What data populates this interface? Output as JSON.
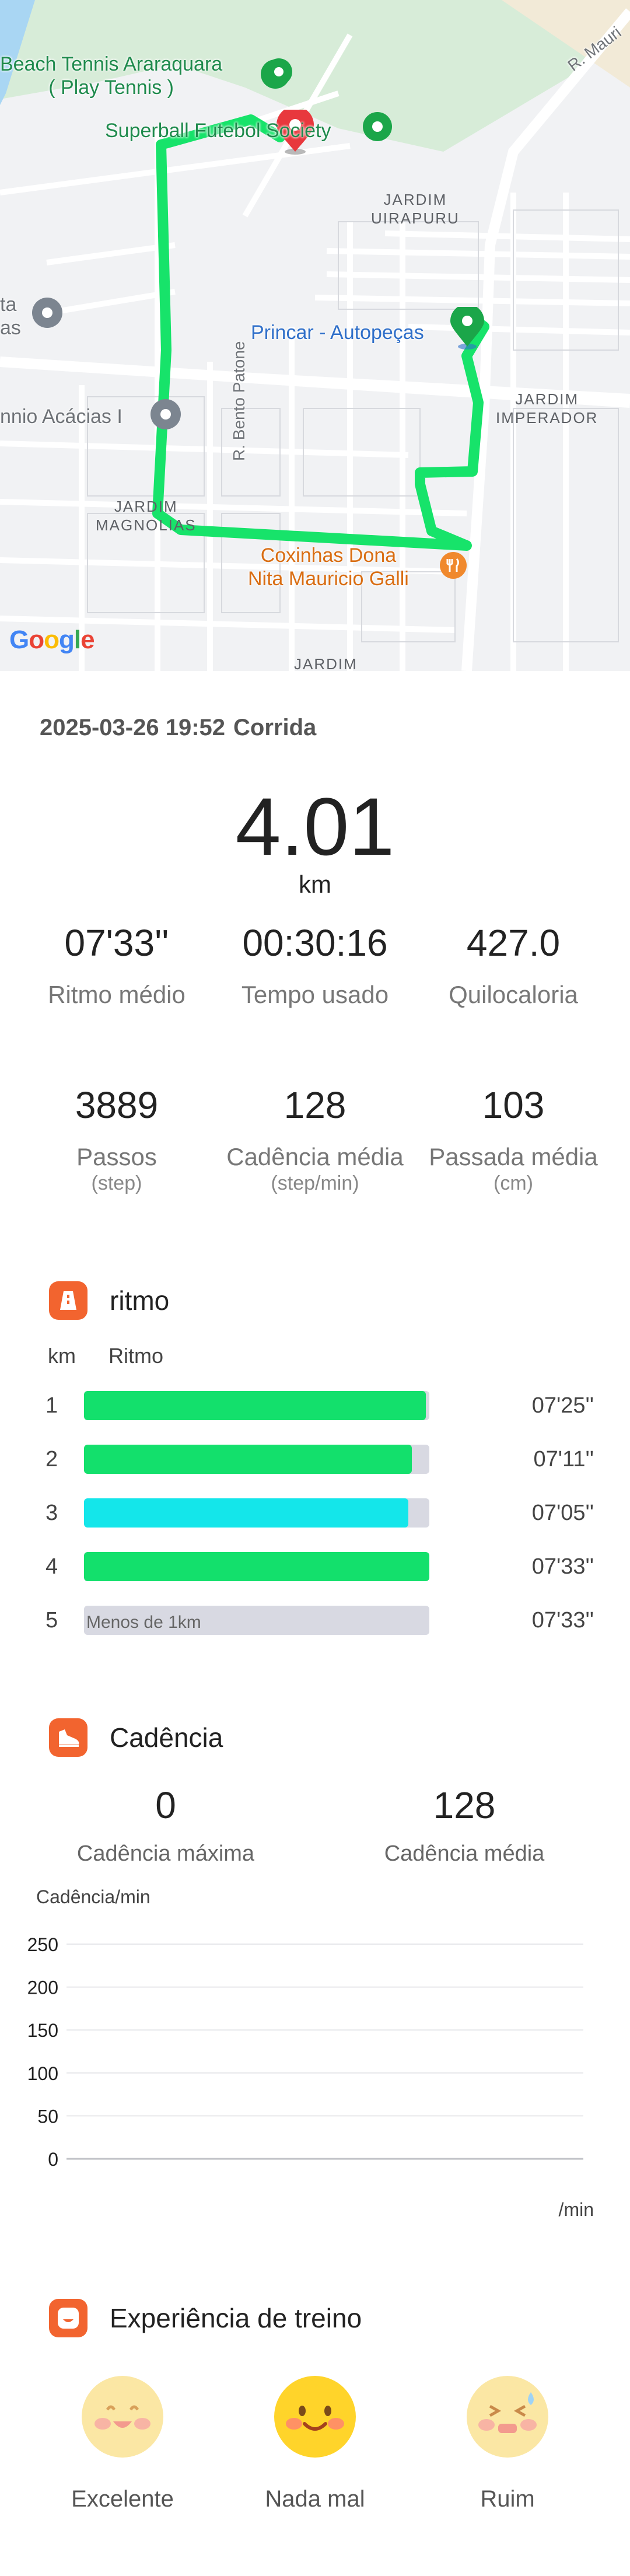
{
  "map": {
    "labels": {
      "beach_tennis": "Beach Tennis Araraquara\n( Play Tennis )",
      "superball": "Superball Futebol Society",
      "princar": "Princar - Autopeças",
      "coxinhas": "Coxinhas Dona\nNita Mauricio Galli",
      "acacias": "nnio Acácias I",
      "ta": "ta\nas",
      "rua_bento": "R. Bento Patone",
      "r_mauri": "R. Mauri",
      "jd_uirapuru": "JARDIM\nUIRAPURU",
      "jd_imperador": "JARDIM\nIMPERADOR",
      "jd_magnolias": "JARDIM\nMAGNOLIAS",
      "jd_bottom": "JARDIM"
    },
    "google": "Google",
    "colors": {
      "route": "#17e36a",
      "start_pin": "#1ba649",
      "end_pin": "#e8383d"
    }
  },
  "workout": {
    "date": "2025-03-26 19:52",
    "type": "Corrida",
    "distance": "4.01",
    "distance_unit": "km"
  },
  "summary": [
    {
      "value": "07'33''",
      "label": "Ritmo médio"
    },
    {
      "value": "00:30:16",
      "label": "Tempo usado"
    },
    {
      "value": "427.0",
      "label": "Quilocaloria"
    }
  ],
  "summary2": [
    {
      "value": "3889",
      "label": "Passos",
      "unit": "(step)"
    },
    {
      "value": "128",
      "label": "Cadência média",
      "unit": "(step/min)"
    },
    {
      "value": "103",
      "label": "Passada média",
      "unit": "(cm)"
    }
  ],
  "pace": {
    "title": "ritmo",
    "col_km": "km",
    "col_pace": "Ritmo",
    "rows": [
      {
        "km": "1",
        "pace": "07'25''",
        "fraction": 0.99,
        "color": "#13e06c",
        "inner": ""
      },
      {
        "km": "2",
        "pace": "07'11''",
        "fraction": 0.95,
        "color": "#13e06c",
        "inner": ""
      },
      {
        "km": "3",
        "pace": "07'05''",
        "fraction": 0.94,
        "color": "#14e6ea",
        "inner": ""
      },
      {
        "km": "4",
        "pace": "07'33''",
        "fraction": 1.0,
        "color": "#13e06c",
        "inner": ""
      },
      {
        "km": "5",
        "pace": "07'33''",
        "fraction": 0.0,
        "color": "#13e06c",
        "inner": "Menos de 1km"
      }
    ]
  },
  "cadence": {
    "title": "Cadência",
    "max_value": "0",
    "max_label": "Cadência máxima",
    "avg_value": "128",
    "avg_label": "Cadência média"
  },
  "chart_data": {
    "type": "line",
    "ylabel": "Cadência/min",
    "xlabel": "/min",
    "yticks": [
      "250",
      "200",
      "150",
      "100",
      "50",
      "0"
    ],
    "ylim": [
      0,
      250
    ],
    "grid": true,
    "series": []
  },
  "experience": {
    "title": "Experiência de treino",
    "options": [
      {
        "label": "Excelente",
        "selected": false
      },
      {
        "label": "Nada mal",
        "selected": true
      },
      {
        "label": "Ruim",
        "selected": false
      }
    ]
  }
}
